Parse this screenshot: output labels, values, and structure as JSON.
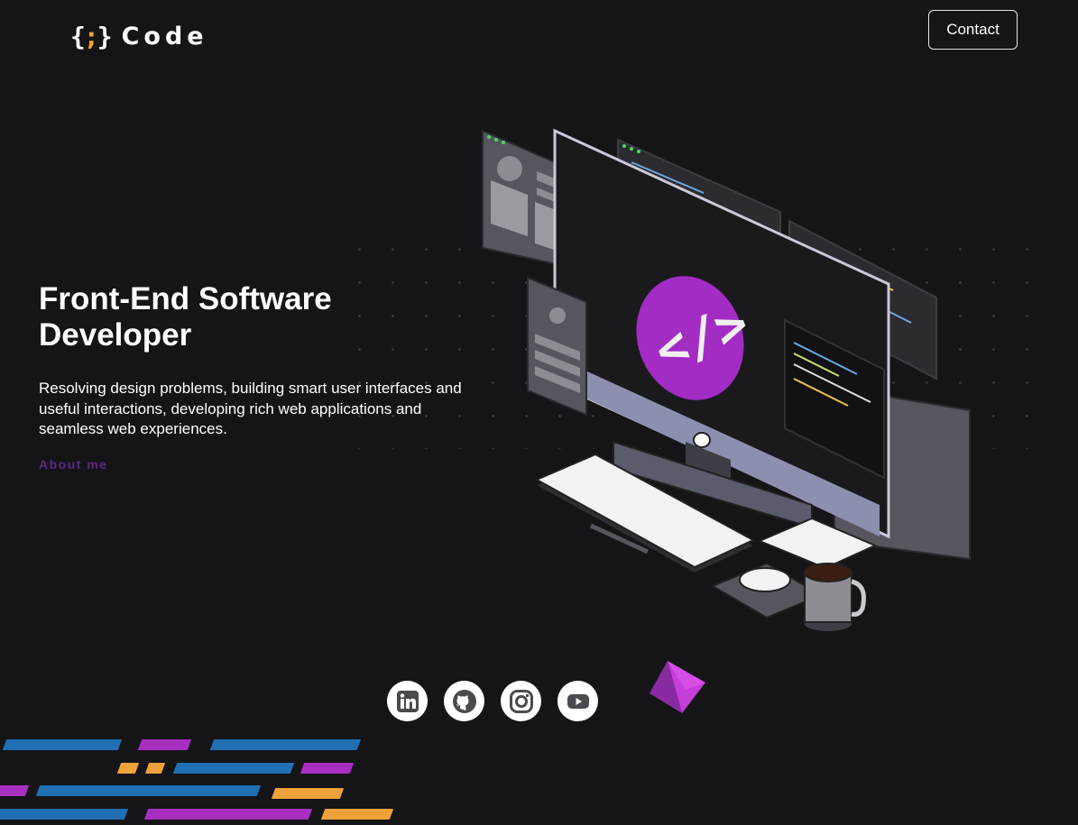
{
  "header": {
    "logo_mark_open": "{",
    "logo_mark_close": "}",
    "logo_text": "Code",
    "contact_label": "Contact"
  },
  "hero": {
    "title": "Front-End Software Developer",
    "description": "Resolving design problems, building smart user interfaces and useful interactions, developing rich web applications and seamless web experiences.",
    "about_label": "About me"
  },
  "socials": [
    {
      "icon": "linkedin-icon"
    },
    {
      "icon": "github-icon"
    },
    {
      "icon": "instagram-icon"
    },
    {
      "icon": "youtube-icon"
    }
  ],
  "colors": {
    "background": "#151417",
    "accent_purple": "#5b2a86",
    "logo_accent": "#f5a623",
    "bar_blue": "#1f6fb2",
    "bar_purple": "#a72fbf",
    "bar_orange": "#f0a23a"
  }
}
